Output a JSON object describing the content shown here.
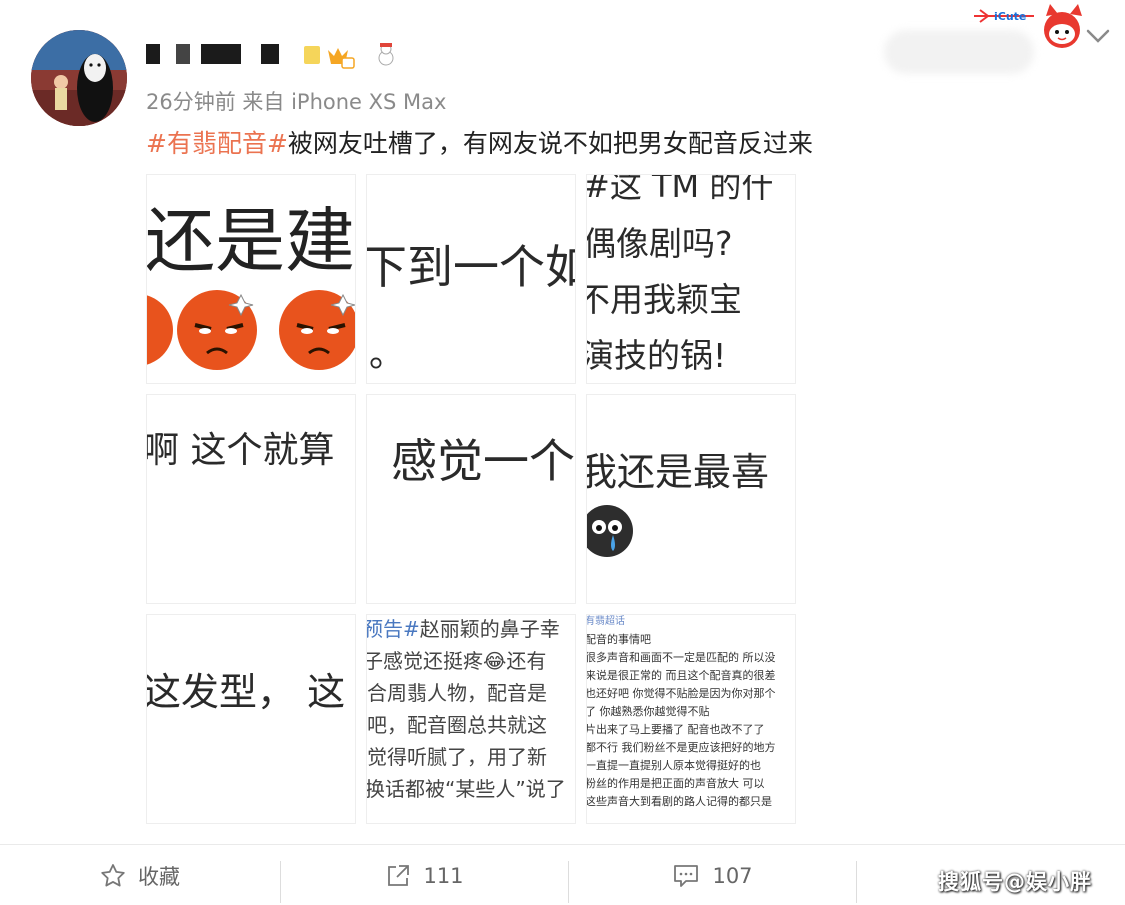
{
  "post": {
    "meta": "26分钟前 来自 iPhone XS Max",
    "text_hashtag": "#有翡配音#",
    "text_body": "被网友吐槽了，有网友说不如把男女配音反过来"
  },
  "images": [
    {
      "text": "还是建"
    },
    {
      "text": "下到一个如",
      "text2": "。"
    },
    {
      "line1": "#这 TM 的什",
      "line2": "偶像剧吗?",
      "line3": "不用我颖宝",
      "line4": "演技的锅!"
    },
    {
      "text": "啊 这个就算"
    },
    {
      "text": "感觉一个"
    },
    {
      "text": "我还是最喜"
    },
    {
      "text": "这发型， 这"
    },
    {
      "lines": [
        "预告#赵丽颖的鼻子幸",
        "子感觉还挺疼😂还有",
        "合周翡人物，配音是",
        "吧，配音圈总共就这",
        "觉得听腻了，用了新",
        "换话都被“某些人”说了"
      ]
    },
    {
      "lines": [
        "有翡超话",
        "配音的事情吧",
        "很多声音和画面不一定是匹配的 所以没",
        "来说是很正常的 而且这个配音真的很差",
        "也还好吧 你觉得不贴脸是因为你对那个",
        "了 你越熟悉你越觉得不贴",
        "片出来了马上要播了 配音也改不了了",
        "都不行 我们粉丝不是更应该把好的地方",
        "一直提一直提别人原本觉得挺好的也",
        "粉丝的作用是把正面的声音放大 可以",
        "这些声音大到看剧的路人记得的都只是"
      ]
    }
  ],
  "actions": {
    "favorite_label": "收藏",
    "repost_count": "111",
    "comment_count": "107"
  },
  "watermark": "搜狐号@娱小胖",
  "colors": {
    "hashtag": "#eb7350",
    "meta": "#8a8a8a",
    "emoji_face": "#e8531d"
  },
  "icons": [
    "star-icon",
    "share-icon",
    "comment-icon",
    "chevron-down-icon"
  ]
}
